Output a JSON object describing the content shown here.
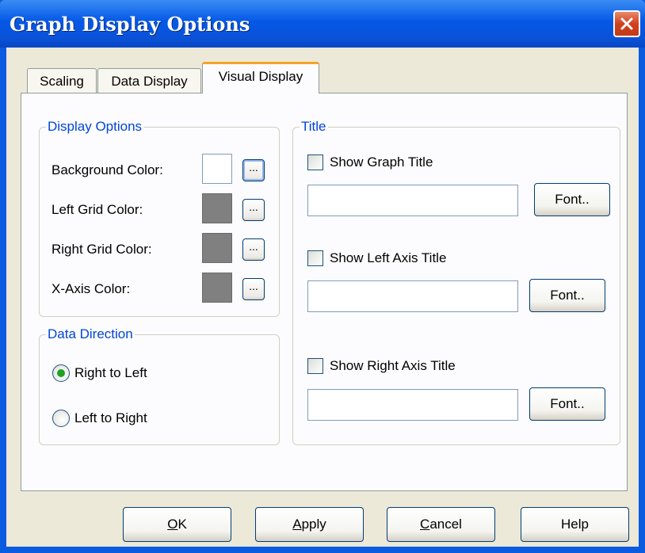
{
  "window": {
    "title": "Graph Display Options"
  },
  "tabs": [
    {
      "label": "Scaling"
    },
    {
      "label": "Data Display"
    },
    {
      "label": "Visual Display",
      "active": true
    }
  ],
  "display_options": {
    "legend": "Display Options",
    "rows": [
      {
        "label": "Background Color:",
        "swatch_color": "#ffffff",
        "button_label": "..."
      },
      {
        "label": "Left Grid Color:",
        "swatch_color": "#808080",
        "button_label": "..."
      },
      {
        "label": "Right Grid Color:",
        "swatch_color": "#808080",
        "button_label": "..."
      },
      {
        "label": "X-Axis Color:",
        "swatch_color": "#808080",
        "button_label": "..."
      }
    ]
  },
  "data_direction": {
    "legend": "Data Direction",
    "options": [
      {
        "label": "Right to Left",
        "selected": true
      },
      {
        "label": "Left to Right",
        "selected": false
      }
    ]
  },
  "title_group": {
    "legend": "Title",
    "sections": [
      {
        "checkbox_label": "Show Graph Title",
        "checked": false,
        "value": "",
        "font_button": "Font.."
      },
      {
        "checkbox_label": "Show Left Axis Title",
        "checked": false,
        "value": "",
        "font_button": "Font.."
      },
      {
        "checkbox_label": "Show Right Axis Title",
        "checked": false,
        "value": "",
        "font_button": "Font.."
      }
    ]
  },
  "buttons": {
    "ok": {
      "mnemonic": "O",
      "rest": "K"
    },
    "apply": {
      "mnemonic": "A",
      "rest": "pply"
    },
    "cancel": {
      "mnemonic": "C",
      "rest": "ancel"
    },
    "help": {
      "label": "Help"
    }
  },
  "colors": {
    "titlebar": "#0458e6",
    "dialog_face": "#ece9d8",
    "legend_text": "#0046d5",
    "active_tab_accent": "#f6a327",
    "close_button": "#d2401f",
    "selected_radio": "#21a121"
  },
  "icons": {
    "close": "close-icon"
  }
}
